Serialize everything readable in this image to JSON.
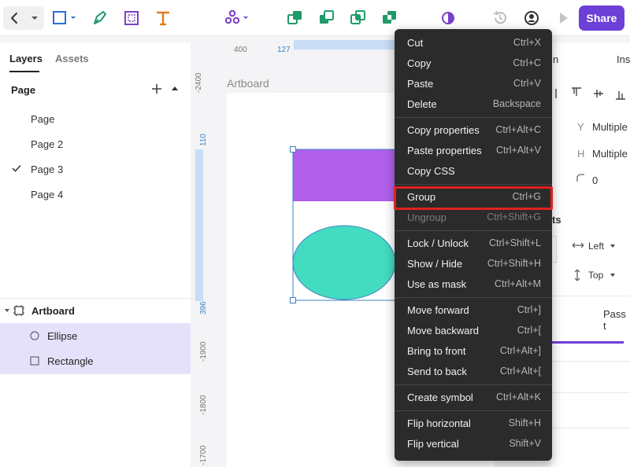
{
  "toolbar": {
    "share_label": "Share"
  },
  "left_panel": {
    "tabs": [
      "Layers",
      "Assets"
    ],
    "pages_title": "Page",
    "pages": [
      "Page",
      "Page 2",
      "Page 3",
      "Page 4"
    ],
    "selected_page": "Page 3",
    "layers": [
      {
        "name": "Artboard"
      },
      {
        "name": "Ellipse"
      },
      {
        "name": "Rectangle"
      }
    ]
  },
  "ruler": {
    "top": [
      "400",
      "127"
    ],
    "left": [
      "-2400",
      "110",
      "396",
      "-1900",
      "-1800",
      "-1700"
    ]
  },
  "canvas": {
    "artboard_label": "Artboard"
  },
  "right_panel": {
    "tab_partial_1": "n",
    "tab_partial_2": "Ins",
    "y_label": "Y",
    "y_value": "Multiple",
    "h_label": "H",
    "h_value": "Multiple",
    "radius_value": "0",
    "section_partial": "ts",
    "align_h": "Left",
    "align_v": "Top",
    "blend_partial": "Pass t"
  },
  "context_menu": {
    "items": [
      {
        "label": "Cut",
        "shortcut": "Ctrl+X"
      },
      {
        "label": "Copy",
        "shortcut": "Ctrl+C"
      },
      {
        "label": "Paste",
        "shortcut": "Ctrl+V"
      },
      {
        "label": "Delete",
        "shortcut": "Backspace"
      },
      {
        "label": "Copy properties",
        "shortcut": "Ctrl+Alt+C"
      },
      {
        "label": "Paste properties",
        "shortcut": "Ctrl+Alt+V"
      },
      {
        "label": "Copy CSS",
        "shortcut": ""
      },
      {
        "label": "Group",
        "shortcut": "Ctrl+G"
      },
      {
        "label": "Ungroup",
        "shortcut": "Ctrl+Shift+G"
      },
      {
        "label": "Lock / Unlock",
        "shortcut": "Ctrl+Shift+L"
      },
      {
        "label": "Show / Hide",
        "shortcut": "Ctrl+Shift+H"
      },
      {
        "label": "Use as mask",
        "shortcut": "Ctrl+Alt+M"
      },
      {
        "label": "Move forward",
        "shortcut": "Ctrl+]"
      },
      {
        "label": "Move backward",
        "shortcut": "Ctrl+["
      },
      {
        "label": "Bring to front",
        "shortcut": "Ctrl+Alt+]"
      },
      {
        "label": "Send to back",
        "shortcut": "Ctrl+Alt+["
      },
      {
        "label": "Create symbol",
        "shortcut": "Ctrl+Alt+K"
      },
      {
        "label": "Flip horizontal",
        "shortcut": "Shift+H"
      },
      {
        "label": "Flip vertical",
        "shortcut": "Shift+V"
      }
    ]
  },
  "colors": {
    "accent": "#6c3fd6",
    "toolbar_icon_green": "#1f9a6a",
    "rect_fill": "#b160ec",
    "ellipse_fill": "#43dcc0",
    "selection": "#3b82c4",
    "highlight": "#e02020"
  }
}
